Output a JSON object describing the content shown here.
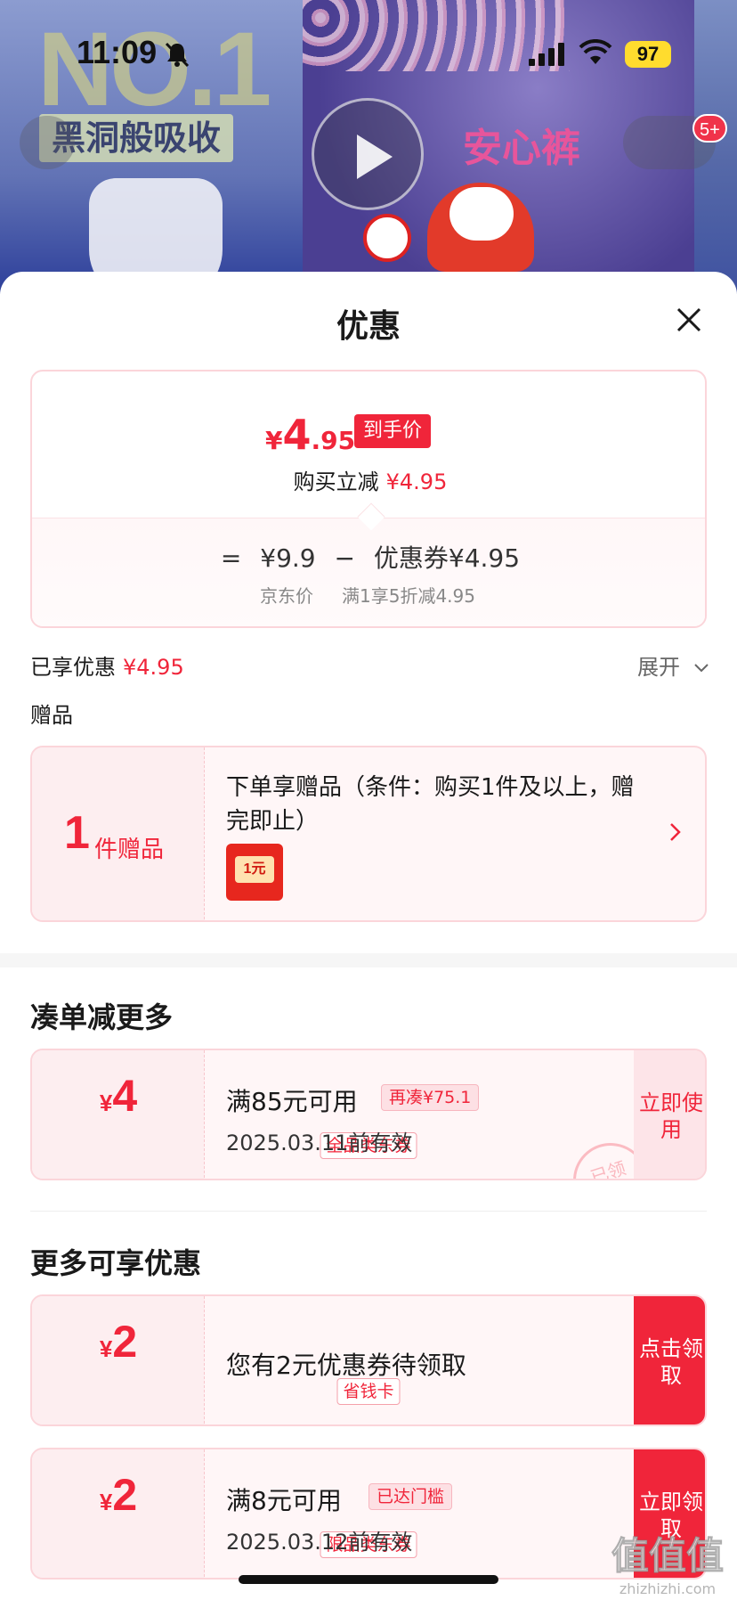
{
  "status_bar": {
    "time": "11:09",
    "battery": "97"
  },
  "banner": {
    "headline": "NO.1",
    "slogan": "黑洞般吸收",
    "brand": "安心裤",
    "cart_count": "5+"
  },
  "sheet": {
    "title": "优惠",
    "price": {
      "currency": "¥",
      "final_int": "4",
      "final_dec": ".95",
      "final_tag": "到手价",
      "reduce_label": "购买立减",
      "reduce_amount": "¥4.95",
      "formula_eq": "=",
      "jd_price": "¥9.9",
      "formula_minus": "−",
      "coupon_part": "优惠券¥4.95",
      "jd_price_label": "京东价",
      "coupon_part_label": "满1享5折减4.95"
    },
    "enjoyed_label": "已享优惠",
    "enjoyed_amount": "¥4.95",
    "expand_label": "展开",
    "gift_heading": "赠品",
    "gift": {
      "count": "1",
      "count_label": "件赠品",
      "description": "下单享赠品（条件：购买1件及以上，赠完即止）",
      "thumb_text": "1元"
    },
    "section_more_discount": "凑单减更多",
    "coupon1": {
      "currency": "¥",
      "amount": "4",
      "type": "全品类东券",
      "condition": "满85元可用",
      "tag": "再凑¥75.1",
      "valid": "2025.03.11前有效",
      "action": "立即使用",
      "stamp": "已领"
    },
    "section_more_offers": "更多可享优惠",
    "coupon2": {
      "currency": "¥",
      "amount": "2",
      "type": "省钱卡",
      "text": "您有2元优惠券待领取",
      "action": "点击领取"
    },
    "coupon3": {
      "currency": "¥",
      "amount": "2",
      "type": "限品类东券",
      "condition": "满8元可用",
      "tag": "已达门槛",
      "valid": "2025.03.12前有效",
      "action": "立即领取"
    }
  },
  "watermark": {
    "logo": "值值值",
    "site": "zhizhizhi.com"
  },
  "colors": {
    "accent": "#f0253a",
    "card_border": "#fbd5da",
    "card_bg": "#fff6f7",
    "battery": "#ffdc2e"
  },
  "icons": [
    "bell-slash-icon",
    "signal-icon",
    "wifi-icon",
    "play-icon",
    "close-icon",
    "chevron-down-icon",
    "chevron-right-icon"
  ]
}
